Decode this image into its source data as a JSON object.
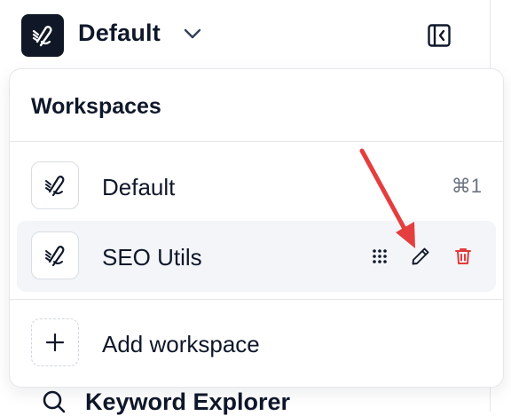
{
  "header": {
    "workspace_name": "Default",
    "chevron_icon": "chevron-down-icon",
    "collapse_icon": "sidebar-collapse-icon"
  },
  "popup": {
    "title": "Workspaces",
    "items": [
      {
        "label": "Default",
        "shortcut": "⌘1",
        "icon": "pen-logo-icon",
        "active": false
      },
      {
        "label": "SEO Utils",
        "icon": "pen-logo-icon",
        "active": true
      }
    ],
    "add_label": "Add workspace",
    "add_icon": "plus-icon"
  },
  "row_actions": {
    "drag_icon": "drag-handle-icon",
    "edit_icon": "pencil-icon",
    "delete_icon": "trash-icon"
  },
  "sidebar": {
    "partial_item": "Keyword Explorer",
    "partial_icon": "search-icon"
  },
  "colors": {
    "logo_bg": "#101827",
    "active_row_bg": "#f3f5f8",
    "delete_red": "#e03b3b",
    "annotation_arrow": "#e53e3e"
  }
}
